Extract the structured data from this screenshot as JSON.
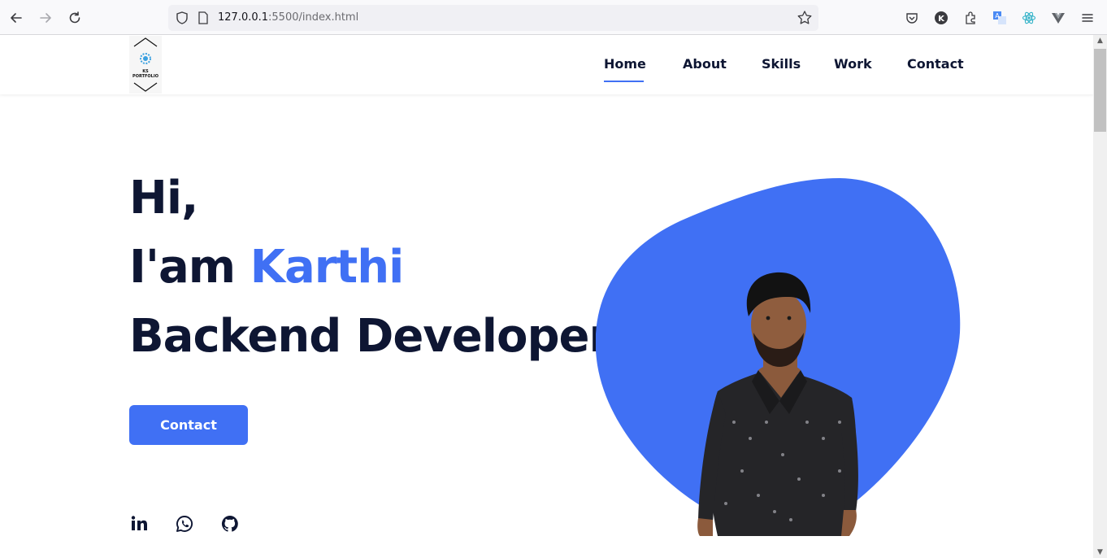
{
  "browser": {
    "url_host": "127.0.0.1",
    "url_rest": ":5500/index.html",
    "extensions": [
      "pocket-icon",
      "k-profile-icon",
      "extensions-icon",
      "translate-icon",
      "react-devtools-icon",
      "vue-devtools-icon",
      "menu-icon"
    ],
    "k_label": "K"
  },
  "logo": {
    "text": "KS PORTFOLIO"
  },
  "nav": {
    "items": [
      "Home",
      "About",
      "Skills",
      "Work",
      "Contact"
    ],
    "active": "Home"
  },
  "hero": {
    "greeting": "Hi,",
    "intro_prefix": "I'am ",
    "name": "Karthi",
    "role": "Backend Developer",
    "cta_label": "Contact"
  },
  "social": [
    "linkedin-icon",
    "whatsapp-icon",
    "github-icon"
  ],
  "colors": {
    "accent": "#4070f4",
    "text": "#0e1633"
  }
}
